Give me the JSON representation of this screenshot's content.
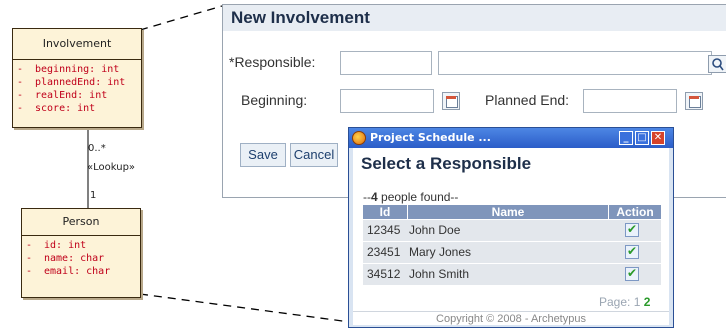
{
  "uml": {
    "involvement": {
      "name": "Involvement",
      "attributes": [
        "beginning: int",
        "plannedEnd: int",
        "realEnd: int",
        "score: int"
      ]
    },
    "person": {
      "name": "Person",
      "attributes": [
        "id: int",
        "name: char",
        "email: char"
      ]
    },
    "association": {
      "multiplicity_top": "0..*",
      "stereotype": "«Lookup»",
      "multiplicity_bottom": "1"
    },
    "attr_prefix": "-"
  },
  "form": {
    "title": "New Involvement",
    "responsible_label": "*Responsible:",
    "beginning_label": "Beginning:",
    "planned_end_label": "Planned End:",
    "save_label": "Save",
    "cancel_label": "Cancel"
  },
  "popup": {
    "window_title": "Project Schedule ...",
    "heading": "Select a Responsible",
    "found_prefix": "--",
    "found_count": "4",
    "found_suffix": " people found--",
    "columns": [
      "Id",
      "Name",
      "Action"
    ],
    "rows": [
      {
        "id": "12345",
        "name": "John Doe"
      },
      {
        "id": "23451",
        "name": "Mary Jones"
      },
      {
        "id": "34512",
        "name": "John Smith"
      }
    ],
    "pager_label": "Page:",
    "pager_page1": "1",
    "pager_page2": "2",
    "copyright": "Copyright © 2008 - Archetypus"
  }
}
